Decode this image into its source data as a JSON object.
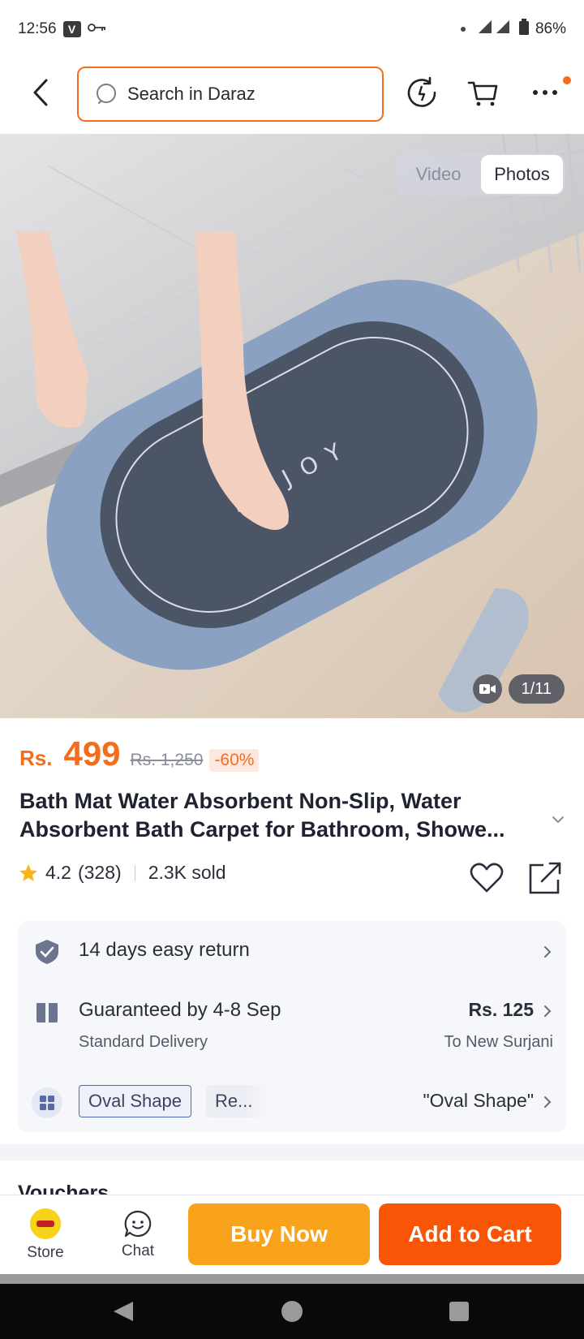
{
  "status": {
    "time": "12:56",
    "badge": "V",
    "battery": "86%"
  },
  "search": {
    "placeholder": "Search in Daraz"
  },
  "gallery": {
    "tabs": [
      "Video",
      "Photos"
    ],
    "active_tab": "Photos",
    "counter": "1/11",
    "mat_text": "ENJOY"
  },
  "product": {
    "currency": "Rs.",
    "price": "499",
    "old_price": "Rs. 1,250",
    "discount": "-60%",
    "title": "Bath Mat Water Absorbent Non-Slip, Water Absorbent Bath Carpet for Bathroom, Showe...",
    "rating": "4.2",
    "reviews": "(328)",
    "sold": "2.3K sold"
  },
  "info": {
    "returns": "14 days easy return",
    "delivery_title": "Guaranteed by 4-8 Sep",
    "delivery_type": "Standard Delivery",
    "delivery_fee": "Rs. 125",
    "delivery_to": "To New Surjani",
    "variant_chip_1": "Oval Shape",
    "variant_chip_2": "Re...",
    "variant_selected": "\"Oval Shape\""
  },
  "vouchers": {
    "title": "Vouchers"
  },
  "bottom": {
    "store": "Store",
    "chat": "Chat",
    "buy_now": "Buy Now",
    "add_to_cart": "Add to Cart"
  },
  "colors": {
    "accent": "#f36d1c",
    "buy_now": "#f9a21b",
    "add_to_cart": "#f85606"
  }
}
